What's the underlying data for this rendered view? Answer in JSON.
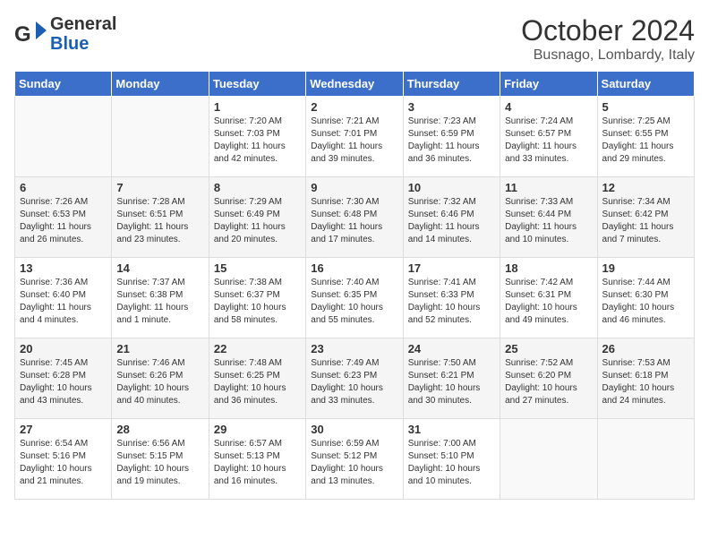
{
  "header": {
    "logo_line1": "General",
    "logo_line2": "Blue",
    "month": "October 2024",
    "location": "Busnago, Lombardy, Italy"
  },
  "days_of_week": [
    "Sunday",
    "Monday",
    "Tuesday",
    "Wednesday",
    "Thursday",
    "Friday",
    "Saturday"
  ],
  "weeks": [
    [
      {
        "day": "",
        "info": ""
      },
      {
        "day": "",
        "info": ""
      },
      {
        "day": "1",
        "info": "Sunrise: 7:20 AM\nSunset: 7:03 PM\nDaylight: 11 hours and 42 minutes."
      },
      {
        "day": "2",
        "info": "Sunrise: 7:21 AM\nSunset: 7:01 PM\nDaylight: 11 hours and 39 minutes."
      },
      {
        "day": "3",
        "info": "Sunrise: 7:23 AM\nSunset: 6:59 PM\nDaylight: 11 hours and 36 minutes."
      },
      {
        "day": "4",
        "info": "Sunrise: 7:24 AM\nSunset: 6:57 PM\nDaylight: 11 hours and 33 minutes."
      },
      {
        "day": "5",
        "info": "Sunrise: 7:25 AM\nSunset: 6:55 PM\nDaylight: 11 hours and 29 minutes."
      }
    ],
    [
      {
        "day": "6",
        "info": "Sunrise: 7:26 AM\nSunset: 6:53 PM\nDaylight: 11 hours and 26 minutes."
      },
      {
        "day": "7",
        "info": "Sunrise: 7:28 AM\nSunset: 6:51 PM\nDaylight: 11 hours and 23 minutes."
      },
      {
        "day": "8",
        "info": "Sunrise: 7:29 AM\nSunset: 6:49 PM\nDaylight: 11 hours and 20 minutes."
      },
      {
        "day": "9",
        "info": "Sunrise: 7:30 AM\nSunset: 6:48 PM\nDaylight: 11 hours and 17 minutes."
      },
      {
        "day": "10",
        "info": "Sunrise: 7:32 AM\nSunset: 6:46 PM\nDaylight: 11 hours and 14 minutes."
      },
      {
        "day": "11",
        "info": "Sunrise: 7:33 AM\nSunset: 6:44 PM\nDaylight: 11 hours and 10 minutes."
      },
      {
        "day": "12",
        "info": "Sunrise: 7:34 AM\nSunset: 6:42 PM\nDaylight: 11 hours and 7 minutes."
      }
    ],
    [
      {
        "day": "13",
        "info": "Sunrise: 7:36 AM\nSunset: 6:40 PM\nDaylight: 11 hours and 4 minutes."
      },
      {
        "day": "14",
        "info": "Sunrise: 7:37 AM\nSunset: 6:38 PM\nDaylight: 11 hours and 1 minute."
      },
      {
        "day": "15",
        "info": "Sunrise: 7:38 AM\nSunset: 6:37 PM\nDaylight: 10 hours and 58 minutes."
      },
      {
        "day": "16",
        "info": "Sunrise: 7:40 AM\nSunset: 6:35 PM\nDaylight: 10 hours and 55 minutes."
      },
      {
        "day": "17",
        "info": "Sunrise: 7:41 AM\nSunset: 6:33 PM\nDaylight: 10 hours and 52 minutes."
      },
      {
        "day": "18",
        "info": "Sunrise: 7:42 AM\nSunset: 6:31 PM\nDaylight: 10 hours and 49 minutes."
      },
      {
        "day": "19",
        "info": "Sunrise: 7:44 AM\nSunset: 6:30 PM\nDaylight: 10 hours and 46 minutes."
      }
    ],
    [
      {
        "day": "20",
        "info": "Sunrise: 7:45 AM\nSunset: 6:28 PM\nDaylight: 10 hours and 43 minutes."
      },
      {
        "day": "21",
        "info": "Sunrise: 7:46 AM\nSunset: 6:26 PM\nDaylight: 10 hours and 40 minutes."
      },
      {
        "day": "22",
        "info": "Sunrise: 7:48 AM\nSunset: 6:25 PM\nDaylight: 10 hours and 36 minutes."
      },
      {
        "day": "23",
        "info": "Sunrise: 7:49 AM\nSunset: 6:23 PM\nDaylight: 10 hours and 33 minutes."
      },
      {
        "day": "24",
        "info": "Sunrise: 7:50 AM\nSunset: 6:21 PM\nDaylight: 10 hours and 30 minutes."
      },
      {
        "day": "25",
        "info": "Sunrise: 7:52 AM\nSunset: 6:20 PM\nDaylight: 10 hours and 27 minutes."
      },
      {
        "day": "26",
        "info": "Sunrise: 7:53 AM\nSunset: 6:18 PM\nDaylight: 10 hours and 24 minutes."
      }
    ],
    [
      {
        "day": "27",
        "info": "Sunrise: 6:54 AM\nSunset: 5:16 PM\nDaylight: 10 hours and 21 minutes."
      },
      {
        "day": "28",
        "info": "Sunrise: 6:56 AM\nSunset: 5:15 PM\nDaylight: 10 hours and 19 minutes."
      },
      {
        "day": "29",
        "info": "Sunrise: 6:57 AM\nSunset: 5:13 PM\nDaylight: 10 hours and 16 minutes."
      },
      {
        "day": "30",
        "info": "Sunrise: 6:59 AM\nSunset: 5:12 PM\nDaylight: 10 hours and 13 minutes."
      },
      {
        "day": "31",
        "info": "Sunrise: 7:00 AM\nSunset: 5:10 PM\nDaylight: 10 hours and 10 minutes."
      },
      {
        "day": "",
        "info": ""
      },
      {
        "day": "",
        "info": ""
      }
    ]
  ]
}
